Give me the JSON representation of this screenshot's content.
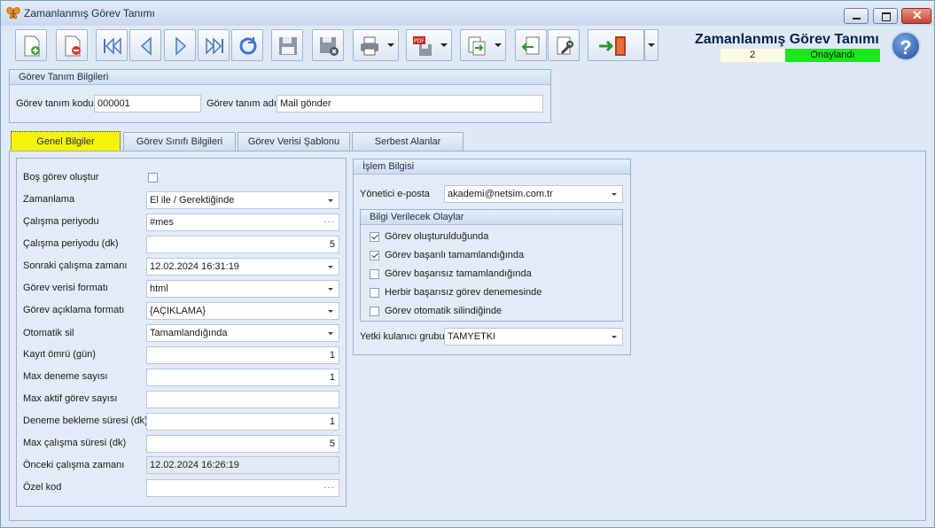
{
  "window": {
    "title": "Zamanlanmış Görev Tanımı"
  },
  "header": {
    "title": "Zamanlanmış Görev Tanımı",
    "number": "2",
    "status": "Onaylandı",
    "status_color": "#1de51d"
  },
  "definition": {
    "group_title": "Görev Tanım Bilgileri",
    "code_label": "Görev tanım kodu",
    "code_value": "000001",
    "name_label": "Görev tanım adı",
    "name_value": "Mail gönder"
  },
  "tabs": [
    {
      "label": "Genel Bilgiler"
    },
    {
      "label": "Görev Sınıfı Bilgileri"
    },
    {
      "label": "Görev Verisi Şablonu"
    },
    {
      "label": "Serbest Alanlar"
    }
  ],
  "general": {
    "rows": [
      {
        "label": "Boş görev oluştur",
        "value": ""
      },
      {
        "label": "Zamanlama",
        "value": "El ile / Gerektiğinde"
      },
      {
        "label": "Çalışma periyodu",
        "value": "#mes"
      },
      {
        "label": "Çalışma periyodu (dk)",
        "value": "5"
      },
      {
        "label": "Sonraki çalışma zamanı",
        "value": "12.02.2024 16:31:19"
      },
      {
        "label": "Görev verisi formatı",
        "value": "html"
      },
      {
        "label": "Görev açıklama formatı",
        "value": "{AÇIKLAMA}"
      },
      {
        "label": "Otomatik sil",
        "value": "Tamamlandığında"
      },
      {
        "label": "Kayıt ömrü (gün)",
        "value": "1"
      },
      {
        "label": "Max deneme sayısı",
        "value": "1"
      },
      {
        "label": "Max aktif görev sayısı",
        "value": ""
      },
      {
        "label": "Deneme bekleme süresi (dk)",
        "value": "1"
      },
      {
        "label": "Max çalışma süresi (dk)",
        "value": "5"
      },
      {
        "label": "Önceki çalışma zamanı",
        "value": "12.02.2024 16:26:19"
      },
      {
        "label": "Özel kod",
        "value": ""
      }
    ]
  },
  "info": {
    "group_title": "İşlem Bilgisi",
    "manager_email_label": "Yönetici e-posta",
    "manager_email_value": "akademi@netsim.com.tr",
    "events_title": "Bilgi Verilecek Olaylar",
    "events": [
      {
        "label": "Görev oluşturulduğunda",
        "checked": true
      },
      {
        "label": "Görev başarılı tamamlandığında",
        "checked": true
      },
      {
        "label": "Görev başarısız tamamlandığında",
        "checked": false
      },
      {
        "label": "Herbir başarısız görev denemesinde",
        "checked": false
      },
      {
        "label": "Görev otomatik silindiğinde",
        "checked": false
      }
    ],
    "auth_group_label": "Yetki kulanıcı grubu",
    "auth_group_value": "TAMYETKI"
  },
  "toolbar": {
    "icons": [
      "new-doc-icon",
      "delete-doc-icon",
      "first-record-icon",
      "previous-record-icon",
      "next-record-icon",
      "last-record-icon",
      "refresh-icon",
      "save-icon",
      "save-cancel-icon",
      "print-icon",
      "pdf-export-icon",
      "export-icon",
      "import-icon",
      "settings-icon",
      "exit-icon"
    ]
  }
}
